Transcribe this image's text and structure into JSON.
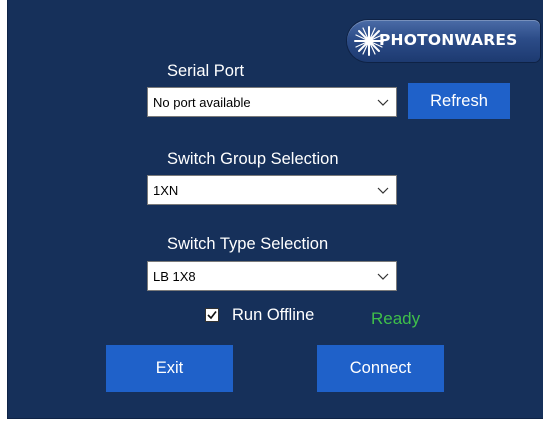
{
  "brand": {
    "logo_text": "PHOTONWARES"
  },
  "serial_port": {
    "label": "Serial Port",
    "selected": "No port available",
    "refresh_label": "Refresh"
  },
  "switch_group": {
    "label": "Switch Group Selection",
    "selected": "1XN"
  },
  "switch_type": {
    "label": "Switch Type Selection",
    "selected": "LB 1X8"
  },
  "run_offline": {
    "label": "Run Offline",
    "checked": true
  },
  "status": {
    "text": "Ready",
    "color": "#3fbf4a"
  },
  "actions": {
    "exit_label": "Exit",
    "connect_label": "Connect"
  },
  "colors": {
    "background": "#16305a",
    "button": "#1f61c9",
    "text": "#ffffff"
  }
}
